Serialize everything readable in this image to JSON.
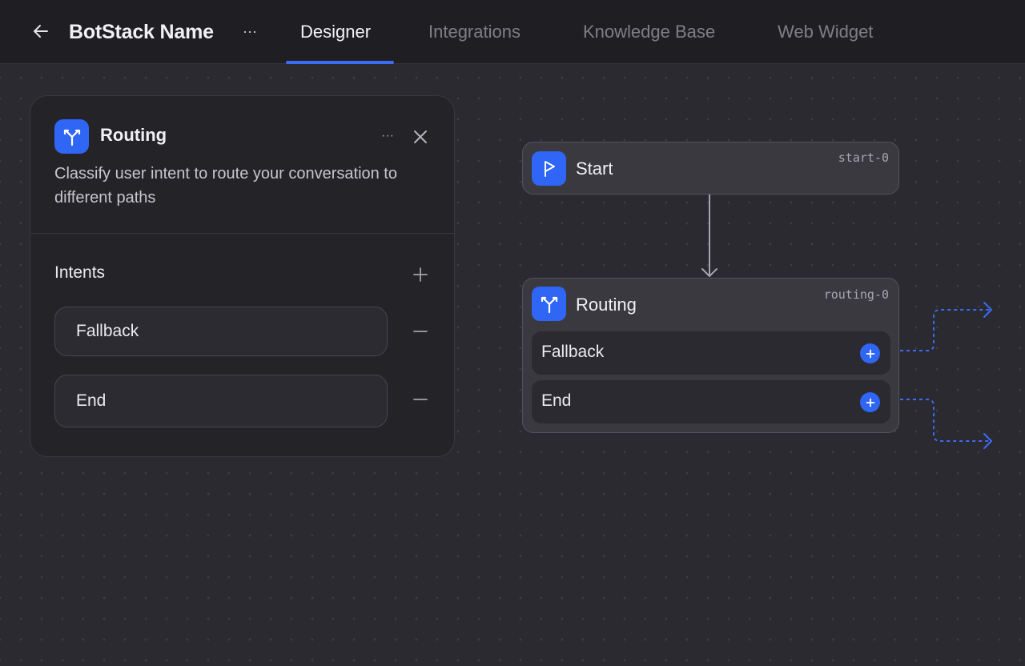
{
  "header": {
    "back_icon": "arrow-left-icon",
    "bot_name": "BotStack Name",
    "menu_label": "···",
    "tabs": [
      {
        "label": "Designer",
        "active": true
      },
      {
        "label": "Integrations",
        "active": false
      },
      {
        "label": "Knowledge Base",
        "active": false
      },
      {
        "label": "Web Widget",
        "active": false
      }
    ]
  },
  "panel": {
    "icon": "routing-icon",
    "title": "Routing",
    "more_label": "···",
    "description": "Classify user intent to route your conversation to different paths",
    "intents_label": "Intents",
    "intents": [
      {
        "value": "Fallback"
      },
      {
        "value": "End"
      }
    ]
  },
  "flow": {
    "start_node": {
      "icon": "flag-icon",
      "title": "Start",
      "id": "start-0"
    },
    "routing_node": {
      "icon": "routing-icon",
      "title": "Routing",
      "id": "routing-0",
      "rows": [
        {
          "label": "Fallback"
        },
        {
          "label": "End"
        }
      ]
    }
  },
  "colors": {
    "accent": "#2f66f5",
    "background": "#2b2a30",
    "topbar": "#1f1f23",
    "panel": "#242428",
    "node": "#3a3940",
    "connector_dashed": "#3b6cf6"
  }
}
